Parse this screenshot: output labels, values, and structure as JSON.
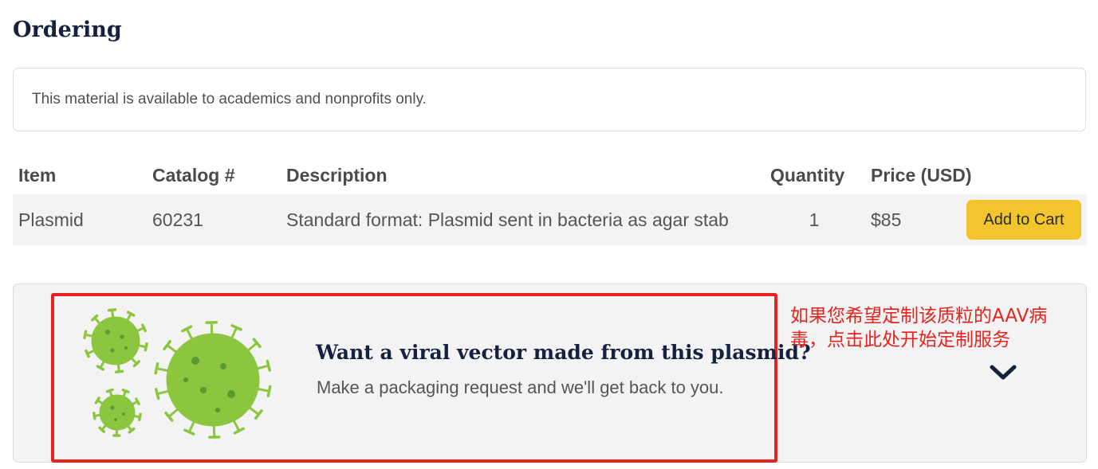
{
  "section": {
    "title": "Ordering"
  },
  "notice": {
    "text": "This material is available to academics and nonprofits only."
  },
  "table": {
    "headers": [
      "Item",
      "Catalog #",
      "Description",
      "Quantity",
      "Price (USD)"
    ],
    "rows": [
      {
        "item": "Plasmid",
        "catalog": "60231",
        "description": "Standard format: Plasmid sent in bacteria as agar stab",
        "quantity": "1",
        "price": "$85",
        "action_label": "Add to Cart"
      }
    ]
  },
  "viral_vector": {
    "title": "Want a viral vector made from this plasmid?",
    "subtitle": "Make a packaging request and we'll get back to you.",
    "illustration_icon": "virus-icon",
    "toggle_icon": "chevron-down-icon"
  },
  "annotation": {
    "text": "如果您希望定制该质粒的AAV病毒，点击此处开始定制服务",
    "color": "#e8231f"
  },
  "colors": {
    "heading": "#15213f",
    "button": "#f2c52d",
    "virus": "#8cc63f",
    "virus_dark": "#5a9a2e",
    "highlight_border": "#e8231f"
  }
}
